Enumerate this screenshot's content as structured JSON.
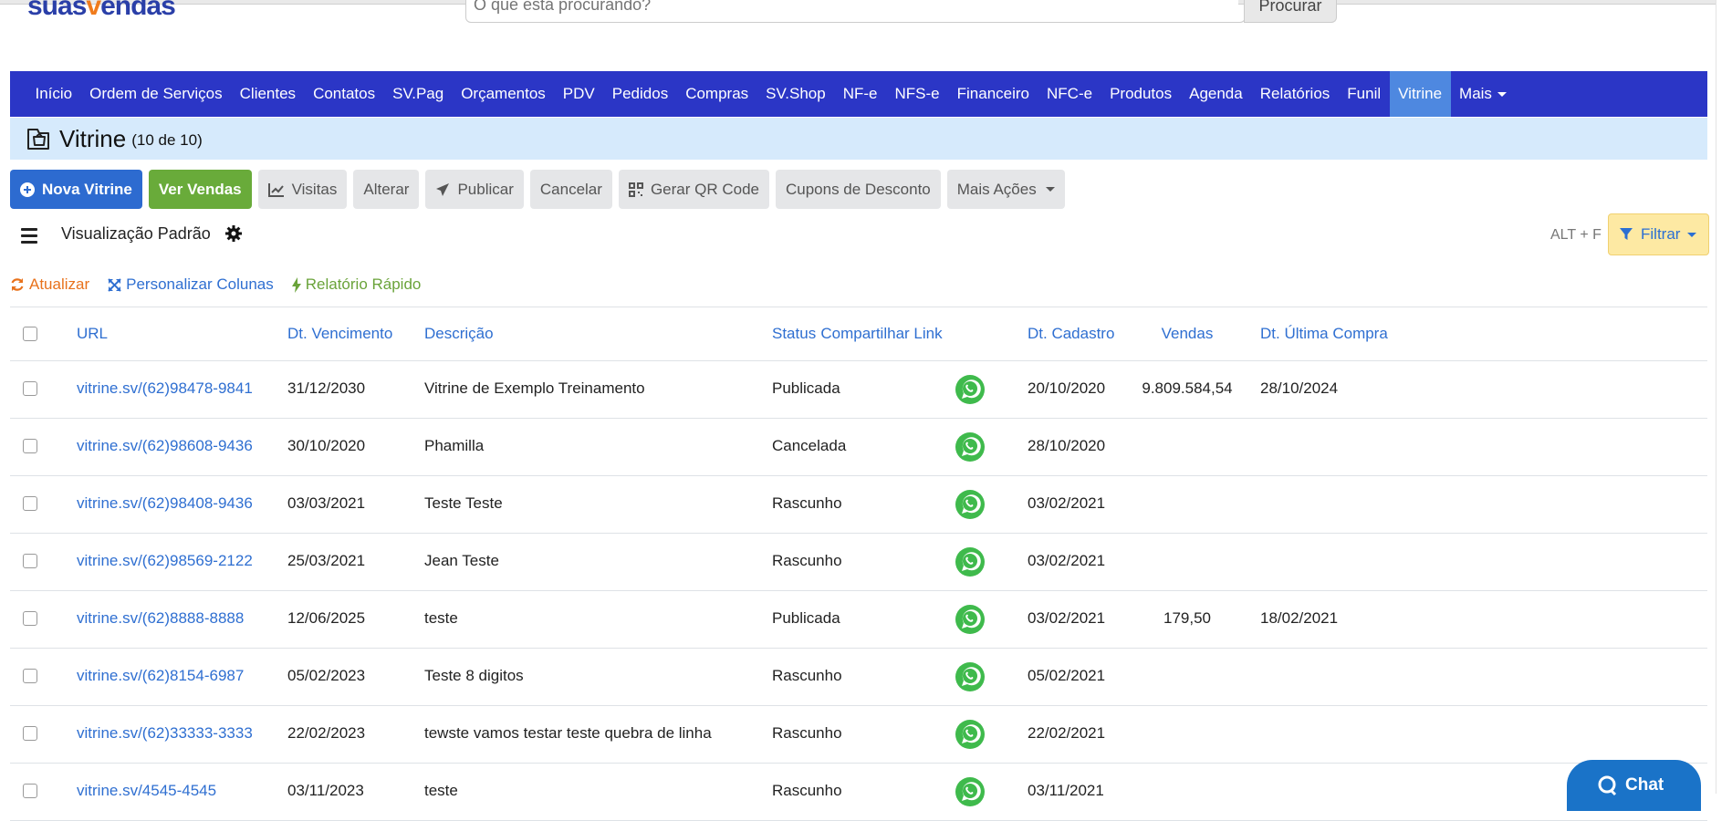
{
  "header": {
    "logo_text_a": "suas",
    "logo_text_b": "v",
    "logo_text_c": "endas",
    "search_placeholder": "O que está procurando?",
    "search_button": "Procurar"
  },
  "nav": {
    "items": [
      {
        "label": "Início"
      },
      {
        "label": "Ordem de Serviços"
      },
      {
        "label": "Clientes"
      },
      {
        "label": "Contatos"
      },
      {
        "label": "SV.Pag"
      },
      {
        "label": "Orçamentos"
      },
      {
        "label": "PDV"
      },
      {
        "label": "Pedidos"
      },
      {
        "label": "Compras"
      },
      {
        "label": "SV.Shop"
      },
      {
        "label": "NF-e"
      },
      {
        "label": "NFS-e"
      },
      {
        "label": "Financeiro"
      },
      {
        "label": "NFC-e"
      },
      {
        "label": "Produtos"
      },
      {
        "label": "Agenda"
      },
      {
        "label": "Relatórios"
      },
      {
        "label": "Funil"
      },
      {
        "label": "Vitrine",
        "active": true
      },
      {
        "label": "Mais",
        "dropdown": true
      }
    ],
    "bg_color": "#2b36c6",
    "active_color": "#4e88e0"
  },
  "page": {
    "title": "Vitrine",
    "count": "(10 de 10)",
    "icon": "storefront-bag-icon"
  },
  "actions": {
    "new": "Nova Vitrine",
    "sales": "Ver Vendas",
    "visits": "Visitas",
    "edit": "Alterar",
    "publish": "Publicar",
    "cancel": "Cancelar",
    "qr": "Gerar QR Code",
    "coupons": "Cupons de Desconto",
    "more": "Mais Ações"
  },
  "view": {
    "label": "Visualização Padrão",
    "shortcut": "ALT + F",
    "filter": "Filtrar"
  },
  "quick_links": {
    "refresh": "Atualizar",
    "columns": "Personalizar Colunas",
    "report": "Relatório Rápido"
  },
  "table": {
    "columns": {
      "url": "URL",
      "due": "Dt. Vencimento",
      "desc": "Descrição",
      "status": "Status",
      "share": "Compartilhar Link",
      "created": "Dt. Cadastro",
      "sales": "Vendas",
      "last": "Dt. Última Compra"
    },
    "rows": [
      {
        "url": "vitrine.sv/(62)98478-9841",
        "due": "31/12/2030",
        "desc": "Vitrine de Exemplo Treinamento",
        "status": "Publicada",
        "created": "20/10/2020",
        "sales": "9.809.584,54",
        "last": "28/10/2024"
      },
      {
        "url": "vitrine.sv/(62)98608-9436",
        "due": "30/10/2020",
        "desc": "Phamilla",
        "status": "Cancelada",
        "created": "28/10/2020",
        "sales": "",
        "last": ""
      },
      {
        "url": "vitrine.sv/(62)98408-9436",
        "due": "03/03/2021",
        "desc": "Teste Teste",
        "status": "Rascunho",
        "created": "03/02/2021",
        "sales": "",
        "last": ""
      },
      {
        "url": "vitrine.sv/(62)98569-2122",
        "due": "25/03/2021",
        "desc": "Jean Teste",
        "status": "Rascunho",
        "created": "03/02/2021",
        "sales": "",
        "last": ""
      },
      {
        "url": "vitrine.sv/(62)8888-8888",
        "due": "12/06/2025",
        "desc": "teste",
        "status": "Publicada",
        "created": "03/02/2021",
        "sales": "179,50",
        "last": "18/02/2021"
      },
      {
        "url": "vitrine.sv/(62)8154-6987",
        "due": "05/02/2023",
        "desc": "Teste 8 digitos",
        "status": "Rascunho",
        "created": "05/02/2021",
        "sales": "",
        "last": ""
      },
      {
        "url": "vitrine.sv/(62)33333-3333",
        "due": "22/02/2023",
        "desc": "tewste vamos testar teste quebra de linha",
        "status": "Rascunho",
        "created": "22/02/2021",
        "sales": "",
        "last": ""
      },
      {
        "url": "vitrine.sv/4545-4545",
        "due": "03/11/2023",
        "desc": "teste",
        "status": "Rascunho",
        "created": "03/11/2021",
        "sales": "",
        "last": ""
      }
    ]
  },
  "chat": {
    "label": "Chat"
  }
}
